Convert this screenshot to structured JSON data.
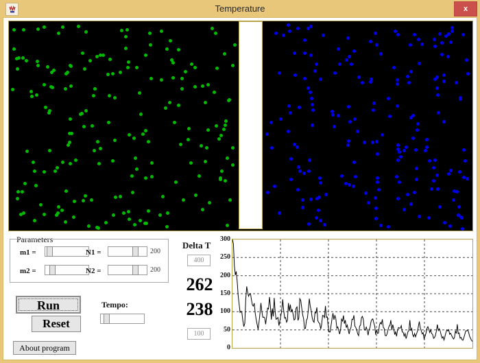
{
  "window": {
    "title": "Temperature",
    "icon": "app-icon",
    "close_label": "x",
    "colors": {
      "frame": "#e8c67a",
      "close": "#cb4f4a",
      "border": "#d6b86b"
    }
  },
  "simulation": {
    "left_panel": {
      "particle_color": "#00bb00",
      "count": 200
    },
    "right_panel": {
      "particle_color": "#0000ee",
      "count": 200
    },
    "divider_color": "#ffffff",
    "background": "#000000"
  },
  "parameters": {
    "legend": "Parameters",
    "rows": [
      {
        "label": "m1 =",
        "slider_pos": 4,
        "right_label": "N1 =",
        "right_slider_pos": 74,
        "right_value": "200"
      },
      {
        "label": "m2 =",
        "slider_pos": 11,
        "right_label": "N2 =",
        "right_slider_pos": 74,
        "right_value": "200"
      }
    ]
  },
  "controls": {
    "run_label": "Run",
    "reset_label": "Reset",
    "about_label": "About program",
    "tempo_label": "Tempo:",
    "tempo_pos": 8
  },
  "deltaT": {
    "title": "Delta T",
    "max_box": "400",
    "min_box": "100",
    "value_top": "262",
    "value_bottom": "238"
  },
  "chart_data": {
    "type": "line",
    "title": "",
    "xlabel": "",
    "ylabel": "",
    "ylim": [
      0,
      300
    ],
    "yticks": [
      300,
      250,
      200,
      150,
      100,
      50,
      0
    ],
    "grid": true,
    "legend": null,
    "line_color": "#000000",
    "x": [
      0,
      1,
      2,
      3,
      4,
      5,
      6,
      7,
      8,
      9,
      10,
      11,
      12,
      13,
      14,
      15,
      16,
      17,
      18,
      19,
      20,
      21,
      22,
      23,
      24,
      25,
      26,
      27,
      28,
      29,
      30,
      31,
      32,
      33,
      34,
      35,
      36,
      37,
      38,
      39,
      40,
      41,
      42,
      43,
      44,
      45,
      46,
      47,
      48,
      49,
      50,
      51,
      52,
      53,
      54,
      55,
      56,
      57,
      58,
      59,
      60,
      61,
      62,
      63,
      64,
      65,
      66,
      67,
      68,
      69,
      70,
      71,
      72,
      73,
      74,
      75,
      76,
      77,
      78,
      79,
      80,
      81,
      82,
      83,
      84,
      85,
      86,
      87,
      88,
      89,
      90,
      91,
      92,
      93,
      94,
      95,
      96,
      97,
      98,
      99,
      100,
      101,
      102,
      103,
      104,
      105,
      106,
      107,
      108,
      109,
      110,
      111,
      112,
      113,
      114,
      115,
      116,
      117,
      118,
      119,
      120,
      121,
      122,
      123,
      124,
      125,
      126,
      127,
      128,
      129,
      130,
      131,
      132,
      133,
      134,
      135,
      136,
      137,
      138,
      139,
      140,
      141,
      142,
      143,
      144,
      145,
      146,
      147,
      148,
      149,
      150,
      151,
      152,
      153,
      154,
      155,
      156,
      157,
      158,
      159,
      160,
      161,
      162,
      163,
      164,
      165,
      166,
      167,
      168,
      169,
      170,
      171,
      172,
      173,
      174,
      175,
      176,
      177,
      178,
      179,
      180,
      181,
      182,
      183,
      184,
      185,
      186,
      187,
      188,
      189,
      190,
      191,
      192,
      193,
      194,
      195,
      196,
      197,
      198,
      199,
      200,
      201,
      202,
      203,
      204,
      205,
      206,
      207,
      208,
      209,
      210,
      211,
      212,
      213,
      214,
      215,
      216,
      217,
      218,
      219,
      220,
      221,
      222,
      223,
      224,
      225,
      226,
      227,
      228,
      229,
      230,
      231,
      232,
      233,
      234,
      235,
      236,
      237,
      238,
      239,
      240,
      241,
      242,
      243,
      244,
      245,
      246,
      247,
      248,
      249
    ],
    "values": [
      300,
      276,
      250,
      236,
      218,
      190,
      150,
      120,
      100,
      92,
      86,
      72,
      65,
      70,
      120,
      150,
      170,
      182,
      160,
      140,
      128,
      118,
      130,
      124,
      100,
      82,
      70,
      64,
      72,
      96,
      118,
      104,
      92,
      80,
      74,
      66,
      78,
      100,
      128,
      118,
      96,
      84,
      90,
      110,
      124,
      116,
      100,
      86,
      78,
      70,
      82,
      96,
      112,
      128,
      120,
      104,
      92,
      86,
      90,
      104,
      118,
      110,
      100,
      88,
      80,
      74,
      86,
      102,
      96,
      88,
      104,
      122,
      110,
      96,
      82,
      74,
      68,
      60,
      66,
      82,
      96,
      112,
      104,
      90,
      78,
      70,
      80,
      96,
      110,
      100,
      86,
      74,
      66,
      58,
      64,
      78,
      92,
      104,
      96,
      84,
      72,
      64,
      56,
      50,
      58,
      70,
      84,
      96,
      88,
      76,
      66,
      58,
      52,
      46,
      54,
      66,
      78,
      88,
      80,
      70,
      62,
      54,
      48,
      44,
      52,
      64,
      76,
      84,
      76,
      66,
      58,
      50,
      46,
      42,
      50,
      60,
      72,
      80,
      72,
      62,
      54,
      48,
      44,
      40,
      48,
      58,
      68,
      76,
      68,
      60,
      52,
      46,
      42,
      38,
      46,
      56,
      66,
      74,
      66,
      58,
      50,
      44,
      40,
      36,
      44,
      54,
      64,
      70,
      62,
      54,
      48,
      42,
      38,
      34,
      42,
      52,
      62,
      68,
      60,
      52,
      46,
      40,
      36,
      32,
      40,
      50,
      60,
      66,
      58,
      50,
      44,
      38,
      34,
      30,
      38,
      48,
      58,
      64,
      56,
      48,
      42,
      36,
      32,
      28,
      36,
      46,
      56,
      62,
      54,
      46,
      40,
      34,
      30,
      26,
      34,
      44,
      54,
      60,
      52,
      44,
      38,
      32,
      28,
      24,
      32,
      42,
      52,
      58,
      50,
      42,
      36,
      30,
      26,
      22,
      30,
      40,
      50,
      56,
      48,
      40,
      34,
      28,
      24,
      20,
      28,
      38,
      48,
      54,
      46,
      38,
      32,
      26,
      22,
      18
    ]
  }
}
